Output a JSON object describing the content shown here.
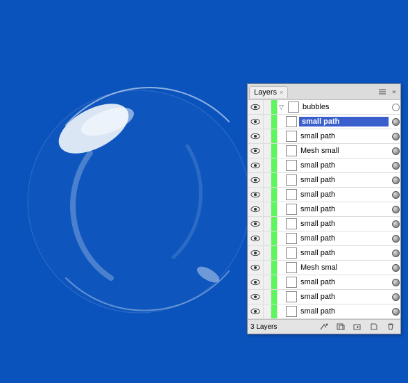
{
  "panel": {
    "tab_label": "Layers",
    "status_text": "3 Layers"
  },
  "parent_layer": {
    "name": "bubbles",
    "visible": true
  },
  "sublayers": [
    {
      "name": "small path",
      "selected": true
    },
    {
      "name": "small path",
      "selected": false
    },
    {
      "name": "Mesh small",
      "selected": false
    },
    {
      "name": "small path",
      "selected": false
    },
    {
      "name": "small path",
      "selected": false
    },
    {
      "name": "small path",
      "selected": false
    },
    {
      "name": "small path",
      "selected": false
    },
    {
      "name": "small path",
      "selected": false
    },
    {
      "name": "small path",
      "selected": false
    },
    {
      "name": "small path",
      "selected": false
    },
    {
      "name": "Mesh smal",
      "selected": false
    },
    {
      "name": "small path",
      "selected": false
    },
    {
      "name": "small path",
      "selected": false
    },
    {
      "name": "small path",
      "selected": false
    }
  ],
  "chart_data": null
}
